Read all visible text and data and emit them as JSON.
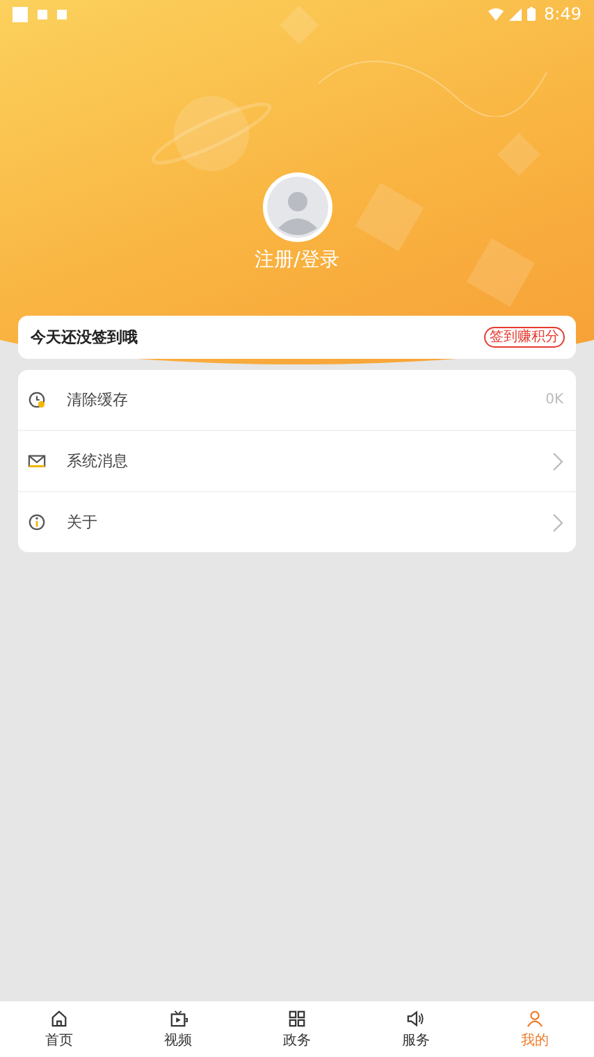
{
  "status_bar": {
    "time": "8:49"
  },
  "profile": {
    "login_label": "注册/登录"
  },
  "checkin": {
    "message": "今天还没签到哦",
    "button": "签到赚积分"
  },
  "menu": [
    {
      "label": "清除缓存",
      "kind": "value",
      "value": "0K"
    },
    {
      "label": "系统消息",
      "kind": "link"
    },
    {
      "label": "关于",
      "kind": "link"
    }
  ],
  "tabs": [
    {
      "label": "首页",
      "selected": false
    },
    {
      "label": "视频",
      "selected": false
    },
    {
      "label": "政务",
      "selected": false
    },
    {
      "label": "服务",
      "selected": false
    },
    {
      "label": "我的",
      "selected": true
    }
  ]
}
